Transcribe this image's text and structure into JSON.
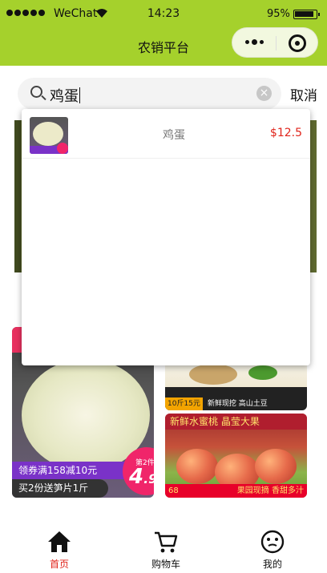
{
  "status_bar": {
    "carrier": "WeChat",
    "time": "14:23",
    "battery": "95%"
  },
  "nav": {
    "title": "农销平台"
  },
  "search": {
    "query": "鸡蛋",
    "cancel_label": "取消"
  },
  "suggestions": [
    {
      "name": "鸡蛋",
      "price": "$12.5"
    }
  ],
  "background_cards": {
    "bamboo": {
      "promo_line1": "领券满158减10元",
      "promo_line2": "买2份送笋片1斤",
      "price_note": "第2件仅",
      "price_int": "4",
      "price_frac": ".9"
    },
    "potato": {
      "tag": "10斤15元",
      "slogan": "新鲜现挖 高山土豆"
    },
    "peach": {
      "title": "新鲜水蜜桃 晶莹大果",
      "price": "68",
      "footer": "果园现摘 香甜多汁"
    }
  },
  "tabbar": {
    "tabs": [
      {
        "label": "首页",
        "icon": "home-icon",
        "active": true
      },
      {
        "label": "购物车",
        "icon": "cart-icon",
        "active": false
      },
      {
        "label": "我的",
        "icon": "profile-icon",
        "active": false
      }
    ]
  },
  "colors": {
    "header_bg": "#a5d12c",
    "active_tab": "#e0241b",
    "price": "#e0241b"
  }
}
